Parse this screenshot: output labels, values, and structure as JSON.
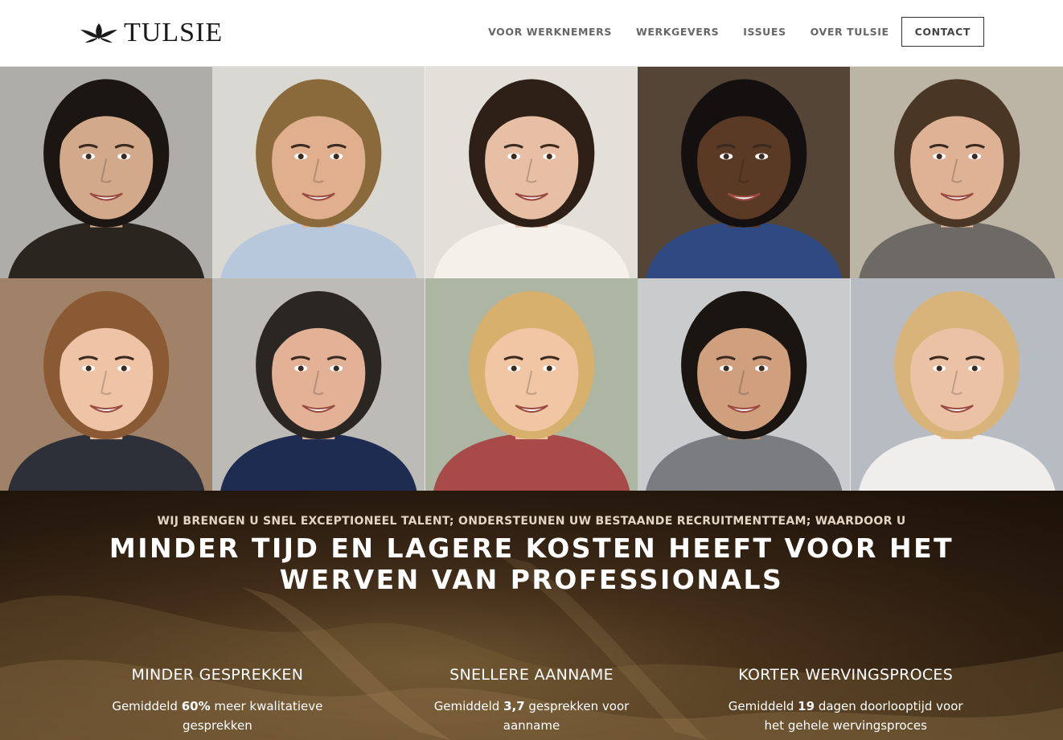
{
  "brand": {
    "name": "TULSIE",
    "logo_icon": "lotus-icon"
  },
  "nav": {
    "items": [
      "VOOR WERKNEMERS",
      "WERKGEVERS",
      "ISSUES",
      "OVER TULSIE"
    ],
    "contact_label": "CONTACT"
  },
  "gallery": {
    "photos": [
      {
        "bg": "#b9b8b4",
        "skin": "#d2a98a",
        "hair": "#1c1612",
        "shirt": "#2b2520"
      },
      {
        "bg": "#e8e6e1",
        "skin": "#e0b08e",
        "hair": "#8a6a3a",
        "shirt": "#b8c8dc"
      },
      {
        "bg": "#f2eee8",
        "skin": "#e6bfa4",
        "hair": "#2e1f17",
        "shirt": "#f5f0ea"
      },
      {
        "bg": "#5a4a3a",
        "skin": "#5b3a25",
        "hair": "#151010",
        "shirt": "#2f4a82"
      },
      {
        "bg": "#c8c0b0",
        "skin": "#dfb296",
        "hair": "#4a3624",
        "shirt": "#6d6a66"
      },
      {
        "bg": "#a98b6e",
        "skin": "#efc3a6",
        "hair": "#8a5a34",
        "shirt": "#2d3038"
      },
      {
        "bg": "#c9c7c2",
        "skin": "#e2b196",
        "hair": "#2a2622",
        "shirt": "#1f2c52"
      },
      {
        "bg": "#b7c2ad",
        "skin": "#f0c6a4",
        "hair": "#d7b06e",
        "shirt": "#a84a4a"
      },
      {
        "bg": "#d6d8da",
        "skin": "#cf9f7e",
        "hair": "#1b1512",
        "shirt": "#7a7c80"
      },
      {
        "bg": "#c2c8cf",
        "skin": "#ecc2a6",
        "hair": "#d8b47a",
        "shirt": "#f0eeec"
      }
    ]
  },
  "hero": {
    "subtitle": "WIJ BRENGEN U SNEL EXCEPTIONEEL TALENT; ONDERSTEUNEN UW BESTAANDE RECRUITMENTTEAM; WAARDOOR U",
    "title_line1": "MINDER TIJD EN LAGERE KOSTEN HEEFT VOOR HET",
    "title_line2": "WERVEN VAN PROFESSIONALS"
  },
  "stats": [
    {
      "title": "MINDER GESPREKKEN",
      "prefix": "Gemiddeld ",
      "value": "60%",
      "suffix": " meer kwalitatieve gesprekken"
    },
    {
      "title": "SNELLERE AANNAME",
      "prefix": "Gemiddeld ",
      "value": "3,7",
      "suffix": " gesprekken voor aanname"
    },
    {
      "title": "KORTER WERVINGSPROCES",
      "prefix": "Gemiddeld ",
      "value": "19",
      "suffix": " dagen doorlooptijd voor het gehele wervingsproces"
    }
  ]
}
